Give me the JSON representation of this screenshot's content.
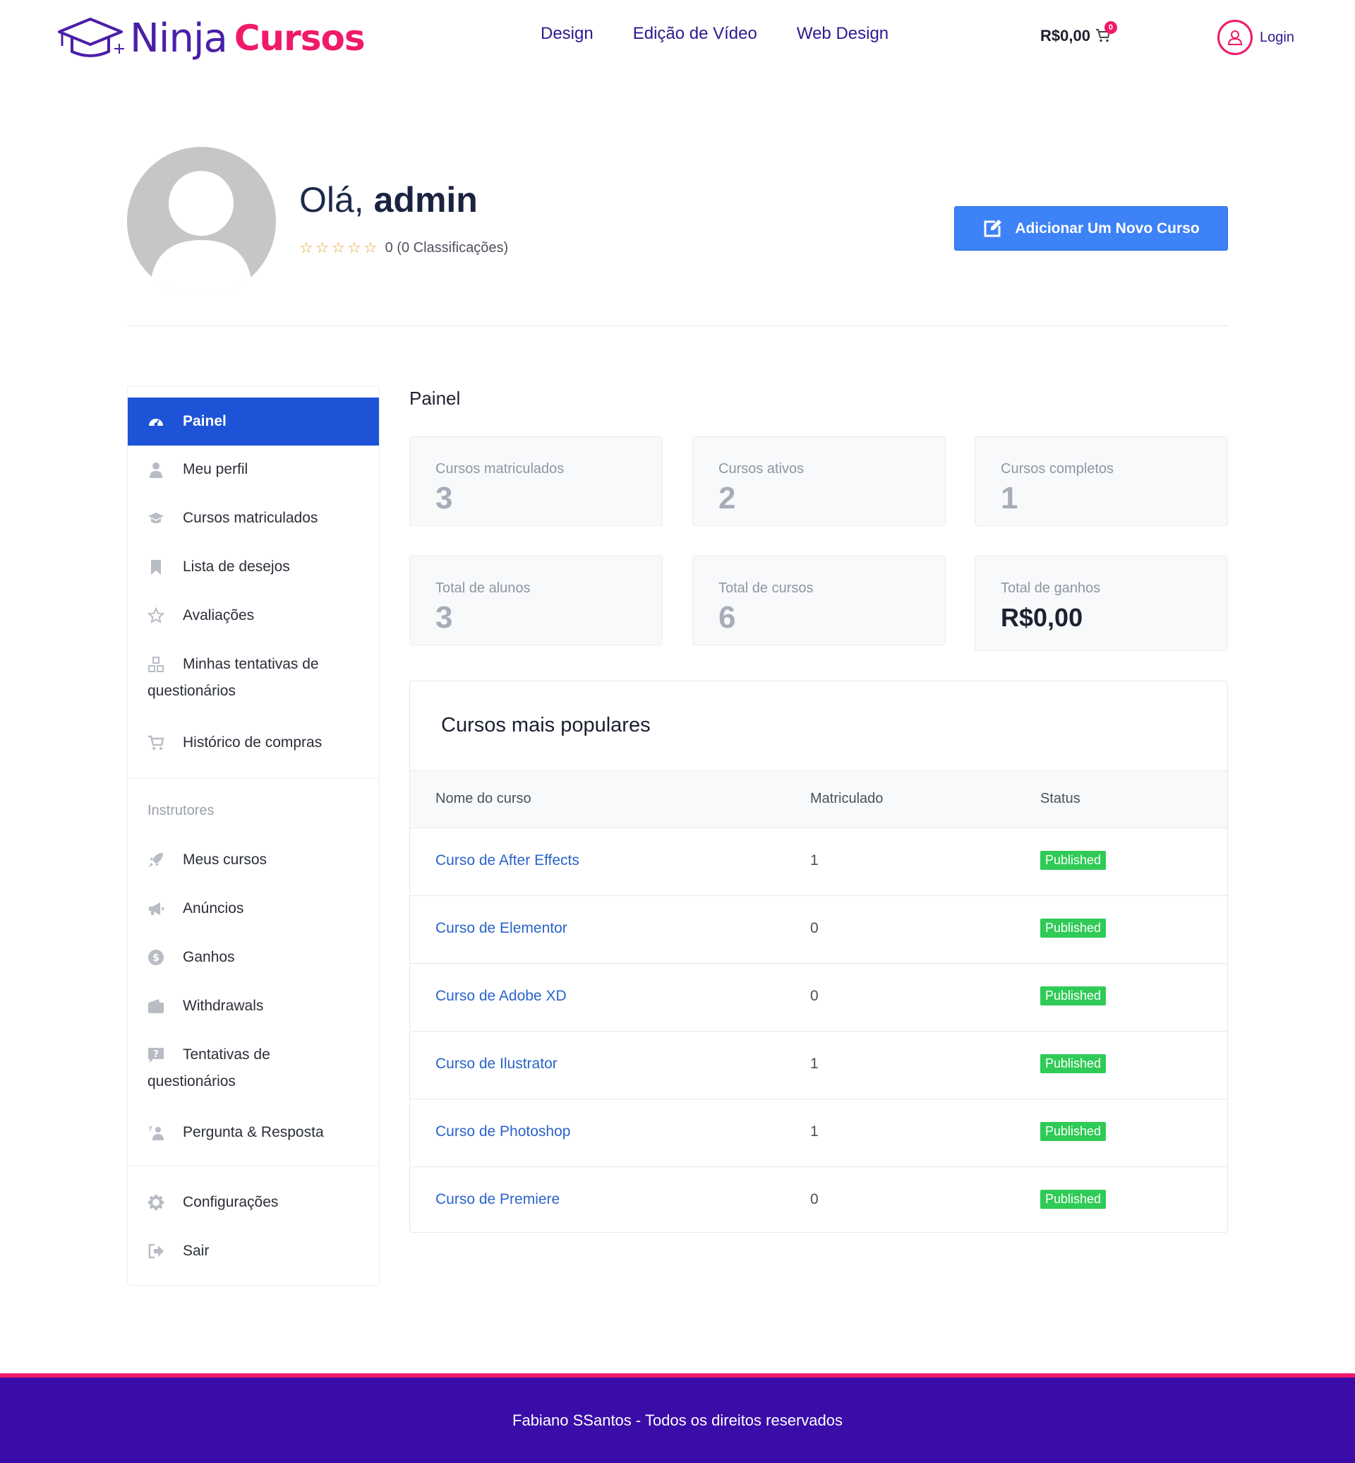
{
  "brand": {
    "name_part1": "Ninja",
    "name_part2": "Cursos"
  },
  "nav": {
    "items": [
      "Design",
      "Edição de Vídeo",
      "Web Design"
    ]
  },
  "cart": {
    "amount": "R$0,00",
    "count": "0"
  },
  "login": {
    "label": "Login"
  },
  "profile": {
    "greeting_prefix": "Olá,",
    "username": "admin",
    "rating_text": "0 (0 Classificações)",
    "add_course_label": "Adicionar Um Novo Curso"
  },
  "sidebar": {
    "items": [
      {
        "label": "Painel",
        "icon": "dashboard-icon",
        "active": true
      },
      {
        "label": "Meu perfil",
        "icon": "user-icon"
      },
      {
        "label": "Cursos matriculados",
        "icon": "graduation-cap-icon"
      },
      {
        "label": "Lista de desejos",
        "icon": "bookmark-icon"
      },
      {
        "label": "Avaliações",
        "icon": "star-icon"
      },
      {
        "label_line1": "Minhas tentativas de",
        "label_line2": "questionários",
        "icon": "quiz-icon"
      },
      {
        "label": "Histórico de compras",
        "icon": "cart-icon"
      }
    ],
    "instructors_heading": "Instrutores",
    "instructor_items": [
      {
        "label": "Meus cursos",
        "icon": "rocket-icon"
      },
      {
        "label": "Anúncios",
        "icon": "megaphone-icon"
      },
      {
        "label": "Ganhos",
        "icon": "dollar-icon"
      },
      {
        "label": "Withdrawals",
        "icon": "wallet-icon"
      },
      {
        "label_line1": "Tentativas de",
        "label_line2": "questionários",
        "icon": "question-icon"
      },
      {
        "label": "Pergunta & Resposta",
        "icon": "qa-icon"
      }
    ],
    "bottom_items": [
      {
        "label": "Configurações",
        "icon": "gear-icon"
      },
      {
        "label": "Sair",
        "icon": "logout-icon"
      }
    ]
  },
  "main": {
    "title": "Painel",
    "stats": [
      {
        "label": "Cursos matriculados",
        "value": "3"
      },
      {
        "label": "Cursos ativos",
        "value": "2"
      },
      {
        "label": "Cursos completos",
        "value": "1"
      },
      {
        "label": "Total de alunos",
        "value": "3"
      },
      {
        "label": "Total de cursos",
        "value": "6"
      },
      {
        "label": "Total de ganhos",
        "value": "R$0,00"
      }
    ],
    "popular": {
      "title": "Cursos mais populares",
      "columns": [
        "Nome do curso",
        "Matriculado",
        "Status"
      ],
      "rows": [
        {
          "name": "Curso de After Effects",
          "enrolled": "1",
          "status": "Published"
        },
        {
          "name": "Curso de Elementor",
          "enrolled": "0",
          "status": "Published"
        },
        {
          "name": "Curso de Adobe XD",
          "enrolled": "0",
          "status": "Published"
        },
        {
          "name": "Curso de Ilustrator",
          "enrolled": "1",
          "status": "Published"
        },
        {
          "name": "Curso de Photoshop",
          "enrolled": "1",
          "status": "Published"
        },
        {
          "name": "Curso de Premiere",
          "enrolled": "0",
          "status": "Published"
        }
      ]
    }
  },
  "footer": {
    "text": "Fabiano SSantos - Todos os direitos reservados"
  },
  "colors": {
    "primary_blue": "#1d53d6",
    "button_blue": "#3e82f7",
    "brand_purple": "#3a0ca8",
    "brand_pink": "#f0196a",
    "published_green": "#2fcb56",
    "star_orange": "#e8a33b"
  }
}
